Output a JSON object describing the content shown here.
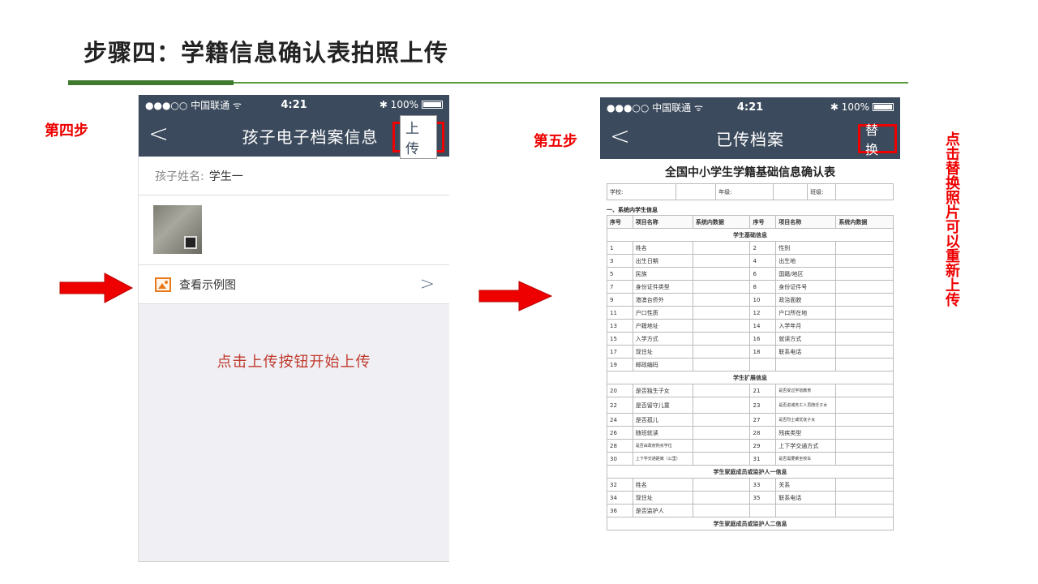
{
  "slide": {
    "title": "步骤四：学籍信息确认表拍照上传",
    "label_step4": "第四步",
    "label_step5": "第五步",
    "hint_vertical": "点击替换照片可以重新上传"
  },
  "phone1": {
    "status": {
      "carrier": "●●●○○ 中国联通 ᯤ",
      "time": "4:21",
      "battery": "✱ 100%"
    },
    "nav": {
      "back": "<",
      "title": "孩子电子档案信息",
      "action": "上传"
    },
    "name_label": "孩子姓名:",
    "name_value": "学生一",
    "example_label": "查看示例图",
    "chevron": ">",
    "hint": "点击上传按钮开始上传"
  },
  "phone2": {
    "status": {
      "carrier": "●●●○○ 中国联通 ᯤ",
      "time": "4:21",
      "battery": "✱ 100%"
    },
    "nav": {
      "back": "<",
      "title": "已传档案",
      "action": "替换"
    },
    "form": {
      "title": "全国中小学生学籍基础信息确认表",
      "school_label": "学校:",
      "grade_label": "年级:",
      "class_label": "班级:",
      "section1": "一、系统内学生信息",
      "headers": [
        "序号",
        "项目名称",
        "系统内数据",
        "序号",
        "项目名称",
        "系统内数据"
      ],
      "sub_basic": "学生基础信息",
      "rows_basic": [
        [
          "1",
          "姓名",
          "2",
          "性别"
        ],
        [
          "3",
          "出生日期",
          "4",
          "出生地"
        ],
        [
          "5",
          "民族",
          "6",
          "国籍/地区"
        ],
        [
          "7",
          "身份证件类型",
          "8",
          "身份证件号"
        ],
        [
          "9",
          "港澳台侨外",
          "10",
          "政治面貌"
        ],
        [
          "11",
          "户口性质",
          "12",
          "户口所在地"
        ],
        [
          "13",
          "户籍地址",
          "14",
          "入学年月"
        ],
        [
          "15",
          "入学方式",
          "16",
          "就读方式"
        ],
        [
          "17",
          "现住址",
          "18",
          "联系电话"
        ],
        [
          "19",
          "邮政编码",
          "",
          ""
        ]
      ],
      "sub_ext": "学生扩展信息",
      "rows_ext": [
        [
          "20",
          "是否独生子女",
          "21",
          "是否受过学前教育"
        ],
        [
          "22",
          "是否留守儿童",
          "23",
          "是否进城务工人员随迁子女"
        ],
        [
          "24",
          "是否孤儿",
          "27",
          "是否烈士或优抚子女"
        ],
        [
          "26",
          "随班就读",
          "28",
          "残疾类型"
        ],
        [
          "28",
          "是否由政府购买学位",
          "29",
          "上下学交通方式"
        ],
        [
          "30",
          "上下学交通距离（公里）",
          "31",
          "是否需要乘坐校车"
        ]
      ],
      "sub_guardian1": "学生家庭成员或监护人一信息",
      "rows_guardian1": [
        [
          "32",
          "姓名",
          "33",
          "关系"
        ],
        [
          "34",
          "现住址",
          "35",
          "联系电话"
        ],
        [
          "36",
          "是否监护人",
          "",
          ""
        ]
      ],
      "sub_guardian2": "学生家庭成员或监护人二信息"
    }
  },
  "colors": {
    "title_rule": "#3f7a2e",
    "navbar": "#3b4a5c",
    "highlight": "#ee0000",
    "hint_text": "#c1392b"
  },
  "icons": [
    "back-chevron-icon",
    "image-icon",
    "chevron-right-icon",
    "wifi-icon",
    "bluetooth-icon",
    "battery-icon",
    "right-arrow-icon"
  ]
}
